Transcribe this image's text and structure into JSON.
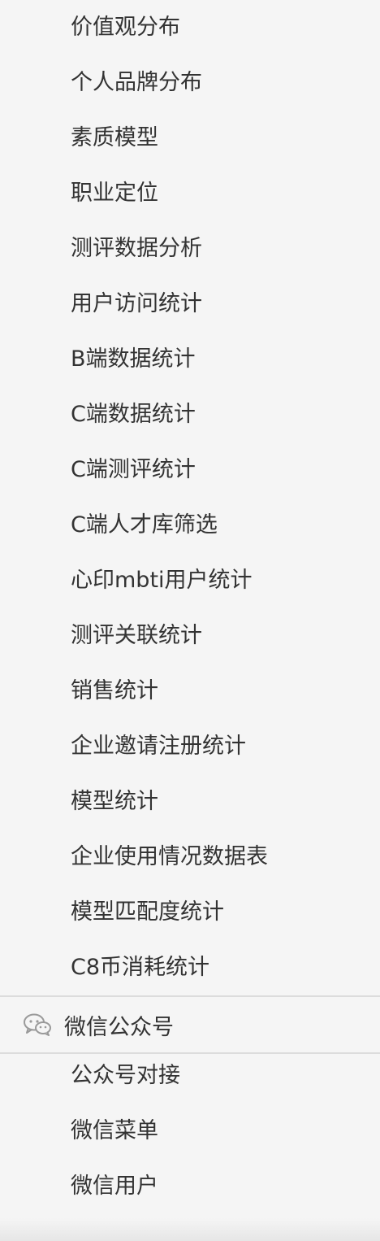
{
  "analytics_items": [
    {
      "label": "价值观分布"
    },
    {
      "label": "个人品牌分布"
    },
    {
      "label": "素质模型"
    },
    {
      "label": "职业定位"
    },
    {
      "label": "测评数据分析"
    },
    {
      "label": "用户访问统计"
    },
    {
      "label": "B端数据统计"
    },
    {
      "label": "C端数据统计"
    },
    {
      "label": "C端测评统计"
    },
    {
      "label": "C端人才库筛选"
    },
    {
      "label": "心印mbti用户统计"
    },
    {
      "label": "测评关联统计"
    },
    {
      "label": "销售统计"
    },
    {
      "label": "企业邀请注册统计"
    },
    {
      "label": "模型统计"
    },
    {
      "label": "企业使用情况数据表"
    },
    {
      "label": "模型匹配度统计"
    },
    {
      "label": "C8币消耗统计"
    }
  ],
  "wechat_group": {
    "label": "微信公众号",
    "icon": "wechat-icon",
    "items": [
      {
        "label": "公众号对接"
      },
      {
        "label": "微信菜单"
      },
      {
        "label": "微信用户"
      }
    ]
  }
}
